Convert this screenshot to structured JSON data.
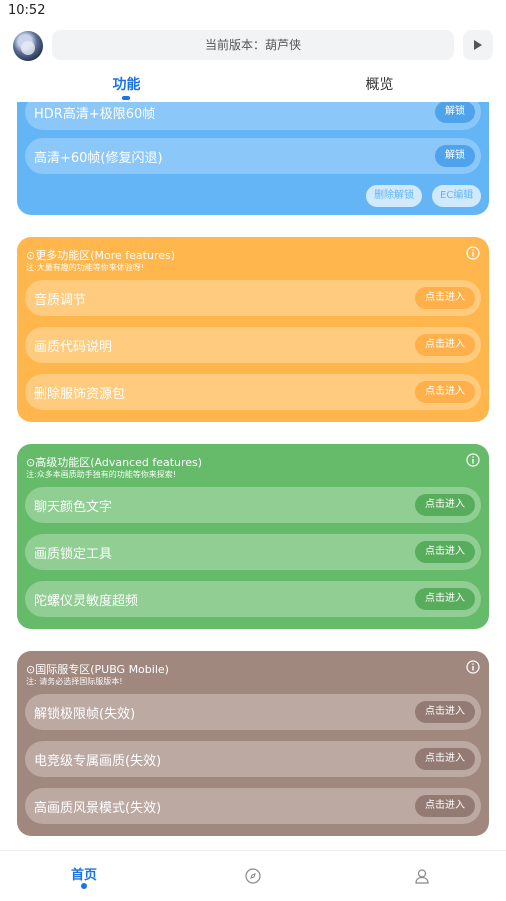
{
  "status_bar": {
    "time": "10:52"
  },
  "header": {
    "version_text": "当前版本：葫芦侠"
  },
  "tabs": [
    {
      "label": "功能",
      "active": true
    },
    {
      "label": "概览",
      "active": false
    }
  ],
  "sections": {
    "blue": {
      "rows": [
        {
          "label": "HDR高清+极限60帧",
          "button": "解锁"
        },
        {
          "label": "高清+60帧(修复闪退)",
          "button": "解锁"
        }
      ],
      "actions": [
        "删除解锁",
        "EC编辑"
      ]
    },
    "more": {
      "title": "⊙更多功能区(More features)",
      "note": "注:大量有趣的功能等你来体验呀!",
      "rows": [
        {
          "label": "音质调节",
          "button": "点击进入"
        },
        {
          "label": "画质代码说明",
          "button": "点击进入"
        },
        {
          "label": "删除服饰资源包",
          "button": "点击进入"
        }
      ]
    },
    "advanced": {
      "title": "⊙高级功能区(Advanced features)",
      "note": "注:众多本画质助手独有的功能等你来探索!",
      "rows": [
        {
          "label": "聊天颜色文字",
          "button": "点击进入"
        },
        {
          "label": "画质锁定工具",
          "button": "点击进入"
        },
        {
          "label": "陀螺仪灵敏度超频",
          "button": "点击进入"
        }
      ]
    },
    "intl": {
      "title": "⊙国际服专区(PUBG Mobile)",
      "note": "注: 请务必选择国际服版本!",
      "rows": [
        {
          "label": "解锁极限帧(失效)",
          "button": "点击进入"
        },
        {
          "label": "电竞级专属画质(失效)",
          "button": "点击进入"
        },
        {
          "label": "高画质风景模式(失效)",
          "button": "点击进入"
        }
      ]
    }
  },
  "bottom_nav": {
    "home_label": "首页",
    "icons": [
      "home",
      "compass-icon",
      "user-icon"
    ]
  },
  "colors": {
    "accent": "#1a73e8",
    "blue": "#64b5f6",
    "orange": "#ffb74d",
    "green": "#66bb6a",
    "brown": "#a1887f"
  }
}
